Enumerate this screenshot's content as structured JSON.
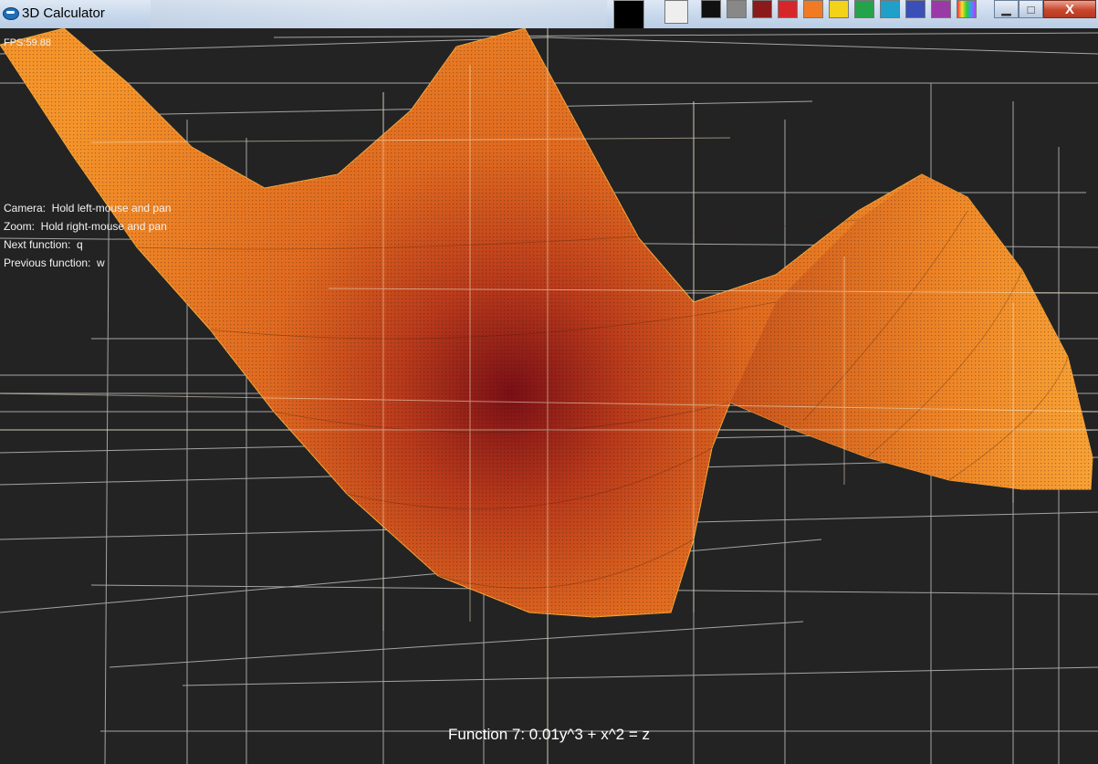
{
  "window": {
    "title": "3D Calculator",
    "minimize_label": "▁",
    "maximize_label": "□",
    "close_label": "X"
  },
  "hud": {
    "fps": "FPS:59.88",
    "camera": "Camera:  Hold left-mouse and pan",
    "zoom": "Zoom:  Hold right-mouse and pan",
    "next": "Next function:  q",
    "previous": "Previous function:  w"
  },
  "function_label": "Function 7: 0.01y^3 + x^2 = z",
  "colors": {
    "background": "#232323",
    "grid": "#d8d8d8",
    "surface_light": "#f08a25",
    "surface_dark": "#7a0f16"
  }
}
